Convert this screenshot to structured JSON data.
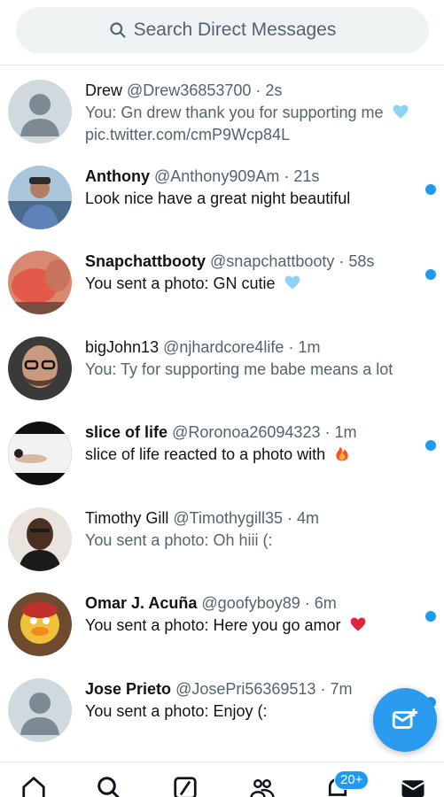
{
  "search": {
    "placeholder": "Search Direct Messages"
  },
  "conversations": [
    {
      "name": "Drew",
      "handle": "@Drew36853700",
      "time": "2s",
      "preview": "You: Gn drew thank you for supporting me",
      "preview_extra": "pic.twitter.com/cmP9Wcp84L",
      "emoji": "blue-heart",
      "unread": false,
      "avatar": "default"
    },
    {
      "name": "Anthony",
      "handle": "@Anthony909Am",
      "time": "21s",
      "preview": "Look nice have a great night beautiful",
      "unread": true,
      "avatar": "photo"
    },
    {
      "name": "Snapchattbooty",
      "handle": "@snapchattbooty",
      "time": "58s",
      "preview": "You sent a photo: GN cutie",
      "emoji": "blue-heart",
      "unread": true,
      "avatar": "photo"
    },
    {
      "name": "bigJohn13",
      "handle": "@njhardcore4life",
      "time": "1m",
      "preview": "You: Ty for supporting me babe means a lot",
      "unread": false,
      "avatar": "photo"
    },
    {
      "name": "slice of life",
      "handle": "@Roronoa26094323",
      "time": "1m",
      "preview": "slice of life reacted to a photo with",
      "emoji": "fire",
      "unread": true,
      "avatar": "photo"
    },
    {
      "name": "Timothy Gill",
      "handle": "@Timothygill35",
      "time": "4m",
      "preview": "You sent a photo: Oh hiii (:",
      "unread": false,
      "avatar": "photo"
    },
    {
      "name": "Omar J. Acuña",
      "handle": "@goofyboy89",
      "time": "6m",
      "preview": "You sent a photo: Here you go amor",
      "emoji": "red-heart",
      "unread": true,
      "avatar": "photo"
    },
    {
      "name": "Jose Prieto",
      "handle": "@JosePri56369513",
      "time": "7m",
      "preview": "You sent a photo: Enjoy (:",
      "unread": true,
      "avatar": "default"
    }
  ],
  "compose": {
    "icon": "new-message-icon"
  },
  "nav": {
    "items": [
      "home-icon",
      "search-icon",
      "grok-icon",
      "communities-icon",
      "notifications-icon",
      "messages-icon"
    ],
    "notifications_badge": "20+"
  },
  "colors": {
    "accent": "#1d9bf0",
    "text": "#0f1419",
    "secondary": "#536471"
  }
}
